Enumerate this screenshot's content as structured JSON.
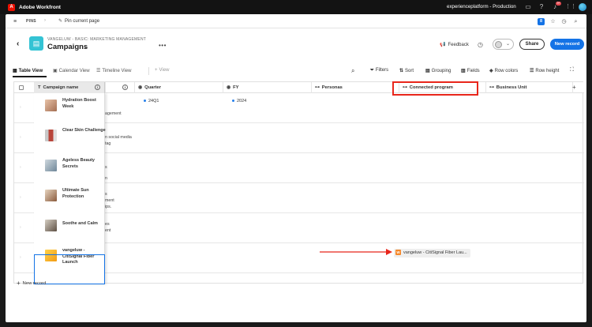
{
  "topbar": {
    "app_name": "Adobe Workfront",
    "logo_letter": "A",
    "org": "experienceplatform - Production",
    "notif_count": "9+"
  },
  "pins": {
    "label": "PINS",
    "pin_current": "Pin current page",
    "badge": "8"
  },
  "header": {
    "breadcrumb": "VANGELUW - BASIC: MARKETING MANAGEMENT",
    "title": "Campaigns",
    "more": "•••",
    "feedback": "Feedback",
    "share": "Share",
    "new_record": "New record"
  },
  "views": {
    "table": "Table View",
    "calendar": "Calendar View",
    "timeline": "Timeline View",
    "add_view": "View"
  },
  "toolbar": {
    "filters": "Filters",
    "sort": "Sort",
    "grouping": "Grouping",
    "fields": "Fields",
    "row_colors": "Row colors",
    "row_height": "Row height"
  },
  "columns": {
    "campaign_name": "Campaign name",
    "quarter": "Quarter",
    "fy": "FY",
    "personas": "Personas",
    "connected_program": "Connected program",
    "business_unit": "Business Unit"
  },
  "rows": [
    {
      "name": "Hydration Boost Week",
      "under": [
        "",
        "agement"
      ],
      "quarter": "24Q1",
      "fy": "2024",
      "thumb": "#c89a7a"
    },
    {
      "name": "Clear Skin Challenge",
      "under": [
        "n social media",
        "tag"
      ],
      "quarter": "",
      "fy": "",
      "thumb": "#b8453a"
    },
    {
      "name": "Ageless Beauty Secrets",
      "under": [
        "s",
        "n"
      ],
      "quarter": "",
      "fy": "",
      "thumb": "#8fa6b8"
    },
    {
      "name": "Ultimate Sun Protection",
      "under": [
        "s",
        "ment",
        "ips."
      ],
      "quarter": "",
      "fy": "",
      "thumb": "#a06a4c"
    },
    {
      "name": "Soothe and Calm",
      "under": [
        "es",
        "ent"
      ],
      "quarter": "",
      "fy": "",
      "thumb": "#7a6a5a"
    },
    {
      "name": "vangeluw - CitiSignal Fiber Launch",
      "under": [],
      "quarter": "",
      "fy": "",
      "thumb": "#f2b418"
    }
  ],
  "connected_value": "vangeluw - CitiSignal Fiber Lau...",
  "connected_icon_letter": "W",
  "new_record_row": "New record",
  "colors": {
    "accent": "#1473e6",
    "highlight": "#e8261b",
    "campaign_icon": "#34c3d4"
  }
}
